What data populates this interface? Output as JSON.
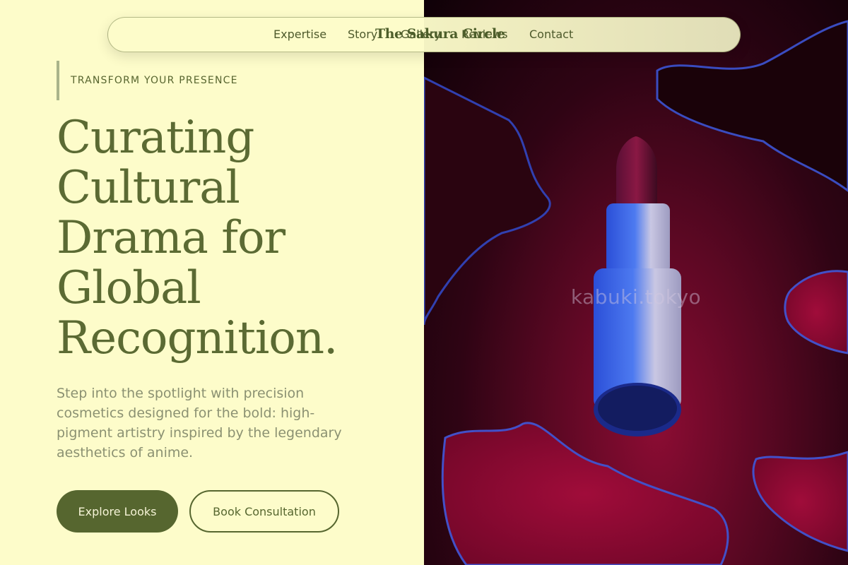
{
  "nav": {
    "links": [
      "Expertise",
      "Story",
      "Gallery",
      "Reviews",
      "Contact"
    ],
    "brand": "The Sakura Circle"
  },
  "hero": {
    "eyebrow": "TRANSFORM YOUR PRESENCE",
    "headline_lines": [
      "Curating",
      "Cultural",
      "Drama for",
      "Global",
      "Recognition."
    ],
    "subcopy_lines": [
      "Step into the spotlight with precision",
      "cosmetics designed for the bold: high-",
      "pigment artistry inspired by the legendary",
      "aesthetics of anime."
    ],
    "primary_cta": "Explore Looks",
    "secondary_cta": "Book Consultation"
  },
  "image": {
    "watermark": "kabuki.tokyo",
    "subject": "lipstick-on-red-puddles"
  },
  "colors": {
    "background": "#fdfcca",
    "accent": "#56662f",
    "headline": "#5b6a33",
    "image_red": "#8c0c33"
  }
}
